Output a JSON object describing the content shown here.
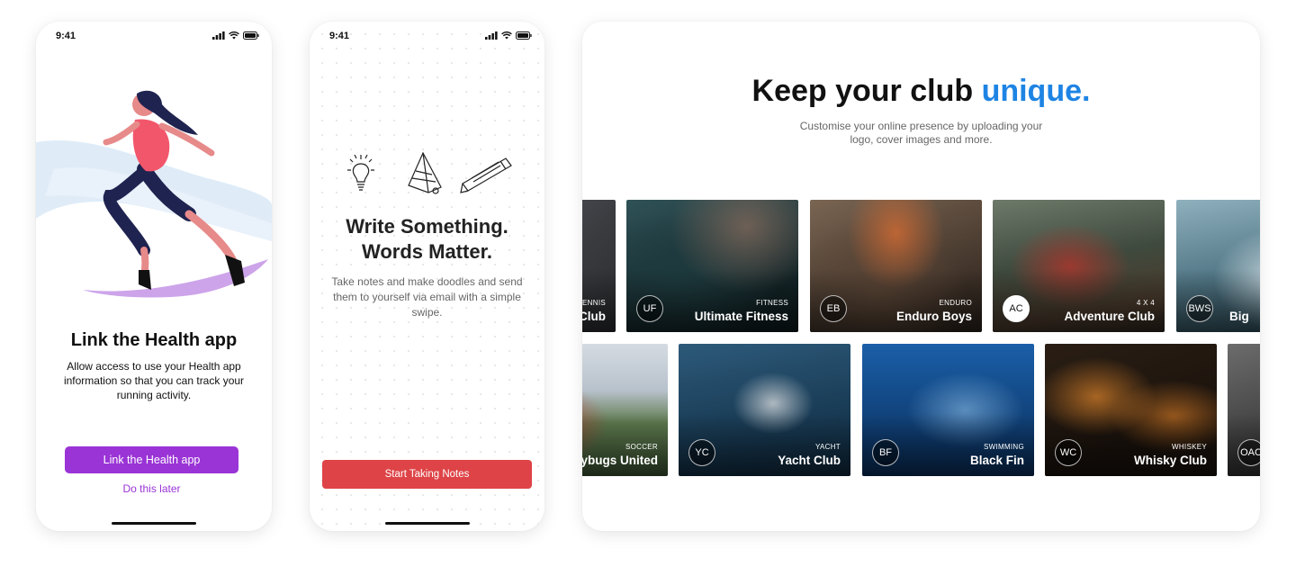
{
  "phone1": {
    "time": "9:41",
    "title": "Link the Health app",
    "body": "Allow access to use your Health app information so that you can track your running activity.",
    "primary_button": "Link the Health app",
    "secondary_link": "Do this later",
    "accent_color": "#9a34d6"
  },
  "phone2": {
    "time": "9:41",
    "title_line1": "Write Something.",
    "title_line2": "Words Matter.",
    "body": "Take notes and make doodles and send them to yourself via email with a simple swipe.",
    "primary_button": "Start Taking Notes",
    "accent_color": "#de4447"
  },
  "tablet": {
    "title": "Keep your club ",
    "title_accent": "unique.",
    "subtitle": "Customise your online presence by uploading your logo, cover images and more.",
    "accent_color": "#1e84e4",
    "row1": [
      {
        "category": "Tennis",
        "name": "Club",
        "avatar": ""
      },
      {
        "category": "Fitness",
        "name": "Ultimate Fitness",
        "avatar": "UF"
      },
      {
        "category": "Enduro",
        "name": "Enduro Boys",
        "avatar": "EB"
      },
      {
        "category": "4 x 4",
        "name": "Adventure Club",
        "avatar": "AC"
      },
      {
        "category": "",
        "name": "Big",
        "avatar": "BWS"
      }
    ],
    "row2": [
      {
        "category": "Soccer",
        "name": "ybugs United",
        "avatar": ""
      },
      {
        "category": "Yacht",
        "name": "Yacht Club",
        "avatar": "YC"
      },
      {
        "category": "Swimming",
        "name": "Black Fin",
        "avatar": "BF"
      },
      {
        "category": "Whiskey",
        "name": "Whisky Club",
        "avatar": "WC"
      },
      {
        "category": "",
        "name": "",
        "avatar": "OAC"
      }
    ]
  }
}
